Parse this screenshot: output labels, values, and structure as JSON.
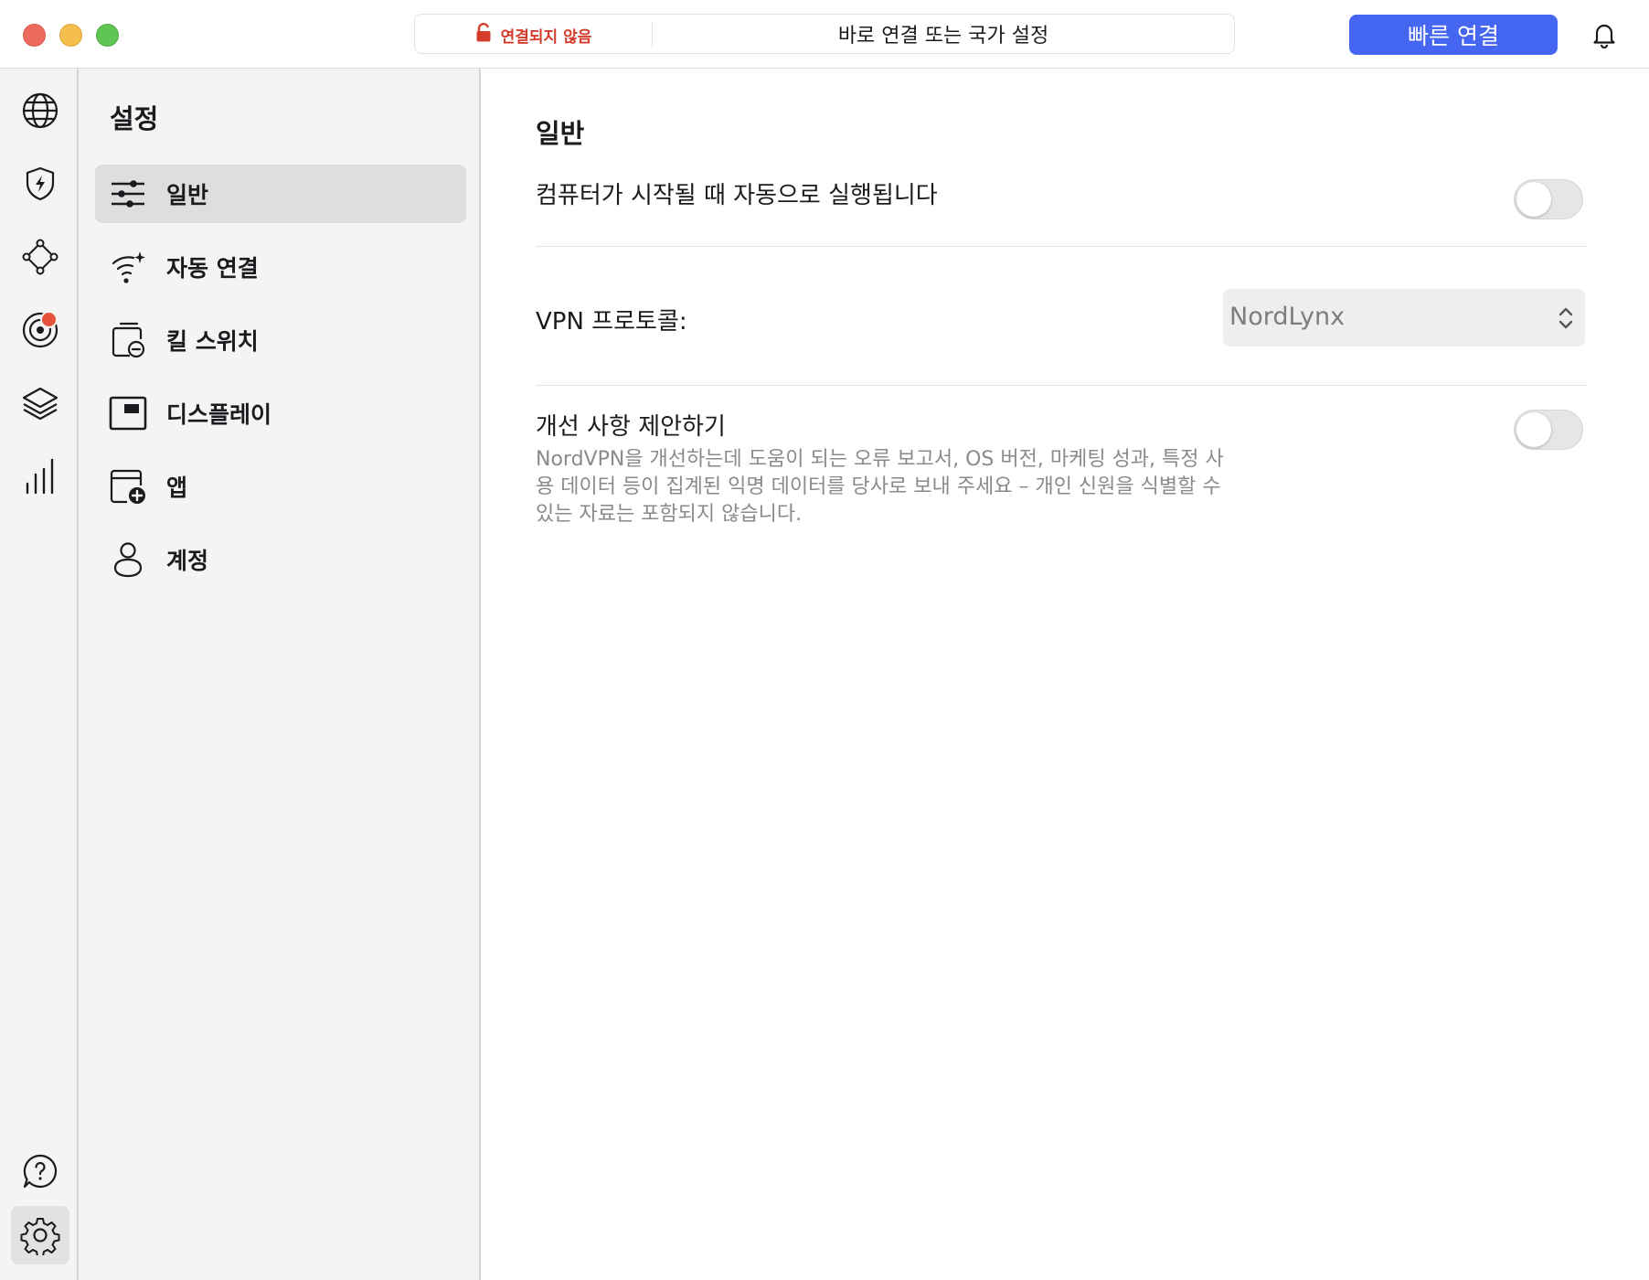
{
  "window": {
    "controls": [
      "close",
      "minimize",
      "zoom"
    ]
  },
  "header": {
    "status_text": "연결되지 않음",
    "status_icon": "unlocked-padlock-icon",
    "status_color": "#d43c2b",
    "search_text": "바로 연결 또는 국가 설정",
    "quick_connect_label": "빠른 연결",
    "accent_color": "#4566f0",
    "notification_icon": "bell-icon"
  },
  "rail": {
    "items": [
      {
        "icon": "globe-icon"
      },
      {
        "icon": "shield-bolt-icon"
      },
      {
        "icon": "meshnet-icon"
      },
      {
        "icon": "target-icon",
        "badge": true
      },
      {
        "icon": "layers-icon"
      },
      {
        "icon": "bar-chart-icon"
      },
      {
        "icon": "help-icon"
      },
      {
        "icon": "gear-icon",
        "active": true
      }
    ]
  },
  "nav": {
    "title": "설정",
    "items": [
      {
        "label": "일반",
        "icon": "sliders-icon",
        "active": true
      },
      {
        "label": "자동 연결",
        "icon": "wifi-sparkle-icon"
      },
      {
        "label": "킬 스위치",
        "icon": "kill-switch-icon"
      },
      {
        "label": "디스플레이",
        "icon": "display-icon"
      },
      {
        "label": "앱",
        "icon": "app-add-icon"
      },
      {
        "label": "계정",
        "icon": "user-icon"
      }
    ]
  },
  "main": {
    "title": "일반",
    "autostart": {
      "label": "컴퓨터가 시작될 때 자동으로 실행됩니다",
      "enabled": false
    },
    "protocol": {
      "label": "VPN 프로토콜:",
      "value": "NordLynx"
    },
    "analytics": {
      "label": "개선 사항 제안하기",
      "enabled": false,
      "description": "NordVPN을 개선하는데 도움이 되는 오류 보고서, OS 버전, 마케팅 성과, 특정 사용 데이터 등이 집계된 익명 데이터를 당사로 보내 주세요 – 개인 신원을 식별할 수 있는 자료는 포함되지 않습니다."
    }
  }
}
